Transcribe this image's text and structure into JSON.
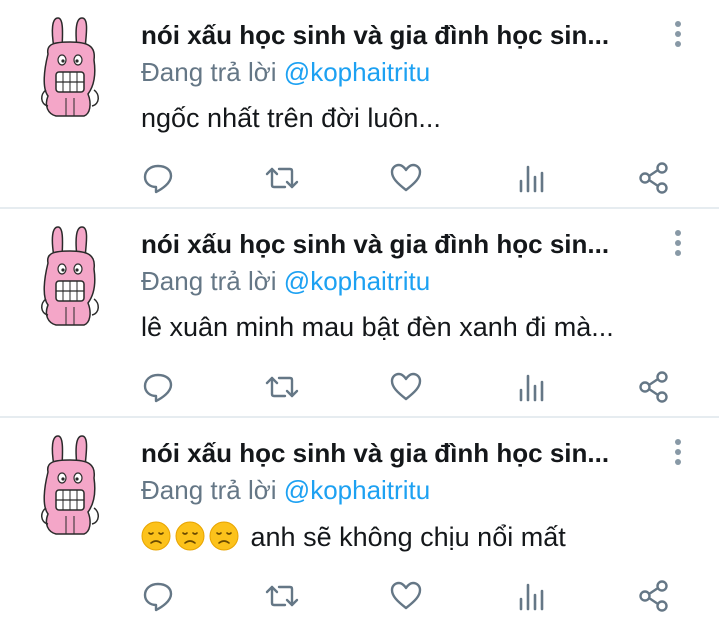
{
  "tweets": [
    {
      "author_name": "nói xấu học sinh và gia đình học sin...",
      "reply_prefix": "Đang trả lời",
      "reply_handle": "@kophaitritu",
      "text": "ngốc nhất trên đời luôn...",
      "emojis": []
    },
    {
      "author_name": "nói xấu học sinh và gia đình học sin...",
      "reply_prefix": "Đang trả lời",
      "reply_handle": "@kophaitritu",
      "text": "lê xuân minh mau bật đèn xanh đi mà...",
      "emojis": []
    },
    {
      "author_name": "nói xấu học sinh và gia đình học sin...",
      "reply_prefix": "Đang trả lời",
      "reply_handle": "@kophaitritu",
      "text": "anh sẽ không chịu nổi mất",
      "emojis": [
        "disappointed-face",
        "disappointed-face",
        "disappointed-face"
      ]
    }
  ],
  "icons": {
    "reply": "speech-bubble-icon",
    "retweet": "retweet-icon",
    "like": "heart-icon",
    "stats": "bar-chart-icon",
    "share": "share-icon",
    "more": "vertical-dots-icon"
  },
  "colors": {
    "name": "#14171a",
    "secondary": "#657786",
    "handle": "#1da1f2",
    "icon": "#657786",
    "separator": "#e6ecf0",
    "avatar_pink": "#f4a6c8"
  }
}
